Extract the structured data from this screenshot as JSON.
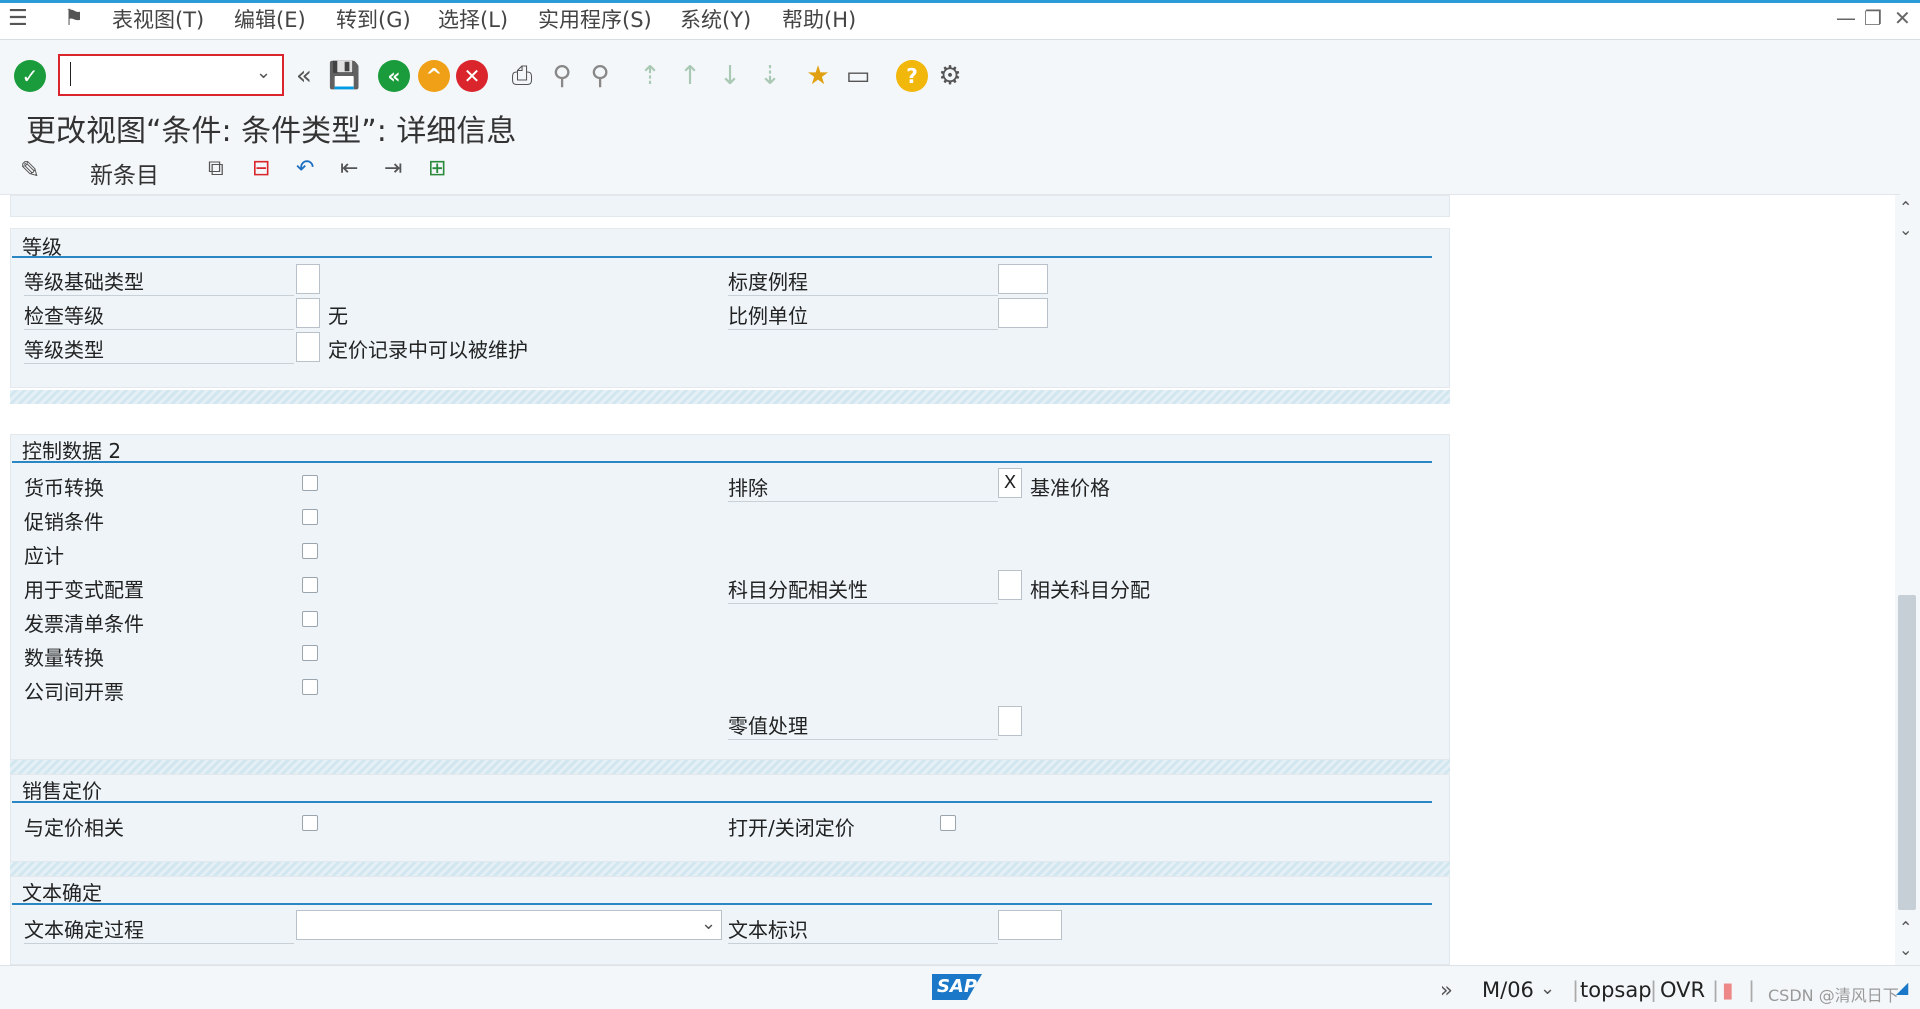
{
  "menu": {
    "items": [
      "表视图(T)",
      "编辑(E)",
      "转到(G)",
      "选择(L)",
      "实用程序(S)",
      "系统(Y)",
      "帮助(H)"
    ]
  },
  "toolbar": {
    "command_field_value": ""
  },
  "title": "更改视图“条件: 条件类型”: 详细信息",
  "app_toolbar": {
    "new_entries": "新条目"
  },
  "groups": {
    "scale": {
      "title": "等级",
      "scale_base_type": "等级基础类型",
      "check_scale": "检查等级",
      "check_scale_text": "无",
      "scale_type": "等级类型",
      "scale_type_text": "定价记录中可以被维护",
      "scale_formula": "标度例程",
      "unit_of_measure": "比例单位"
    },
    "control2": {
      "title": "控制数据 2",
      "currency_conversion": "货币转换",
      "promotion_condition": "促销条件",
      "accruals": "应计",
      "variant_config": "用于变式配置",
      "invoice_list": "发票清单条件",
      "qty_conversion": "数量转换",
      "intercompany": "公司间开票",
      "exclusion": "排除",
      "exclusion_value": "X",
      "exclusion_text": "基准价格",
      "acct_assignment": "科目分配相关性",
      "acct_assignment_text": "相关科目分配",
      "zero_value": "零值处理"
    },
    "sales_pricing": {
      "title": "销售定价",
      "pricing_relevant": "与定价相关",
      "pricing_on_off": "打开/关闭定价"
    },
    "text_determination": {
      "title": "文本确定",
      "text_procedure": "文本确定过程",
      "text_id": "文本标识"
    }
  },
  "status": {
    "logo": "SAP",
    "session": "M/06",
    "server": "topsap",
    "mode": "OVR",
    "watermark": "CSDN @清风日下"
  },
  "colors": {
    "accent": "#2a87c4",
    "ok_green": "#1a9b3c",
    "back_green": "#1a9b3c",
    "exit_orange": "#f0a017",
    "cancel_red": "#d9252b",
    "help_yellow": "#f2b70b"
  }
}
